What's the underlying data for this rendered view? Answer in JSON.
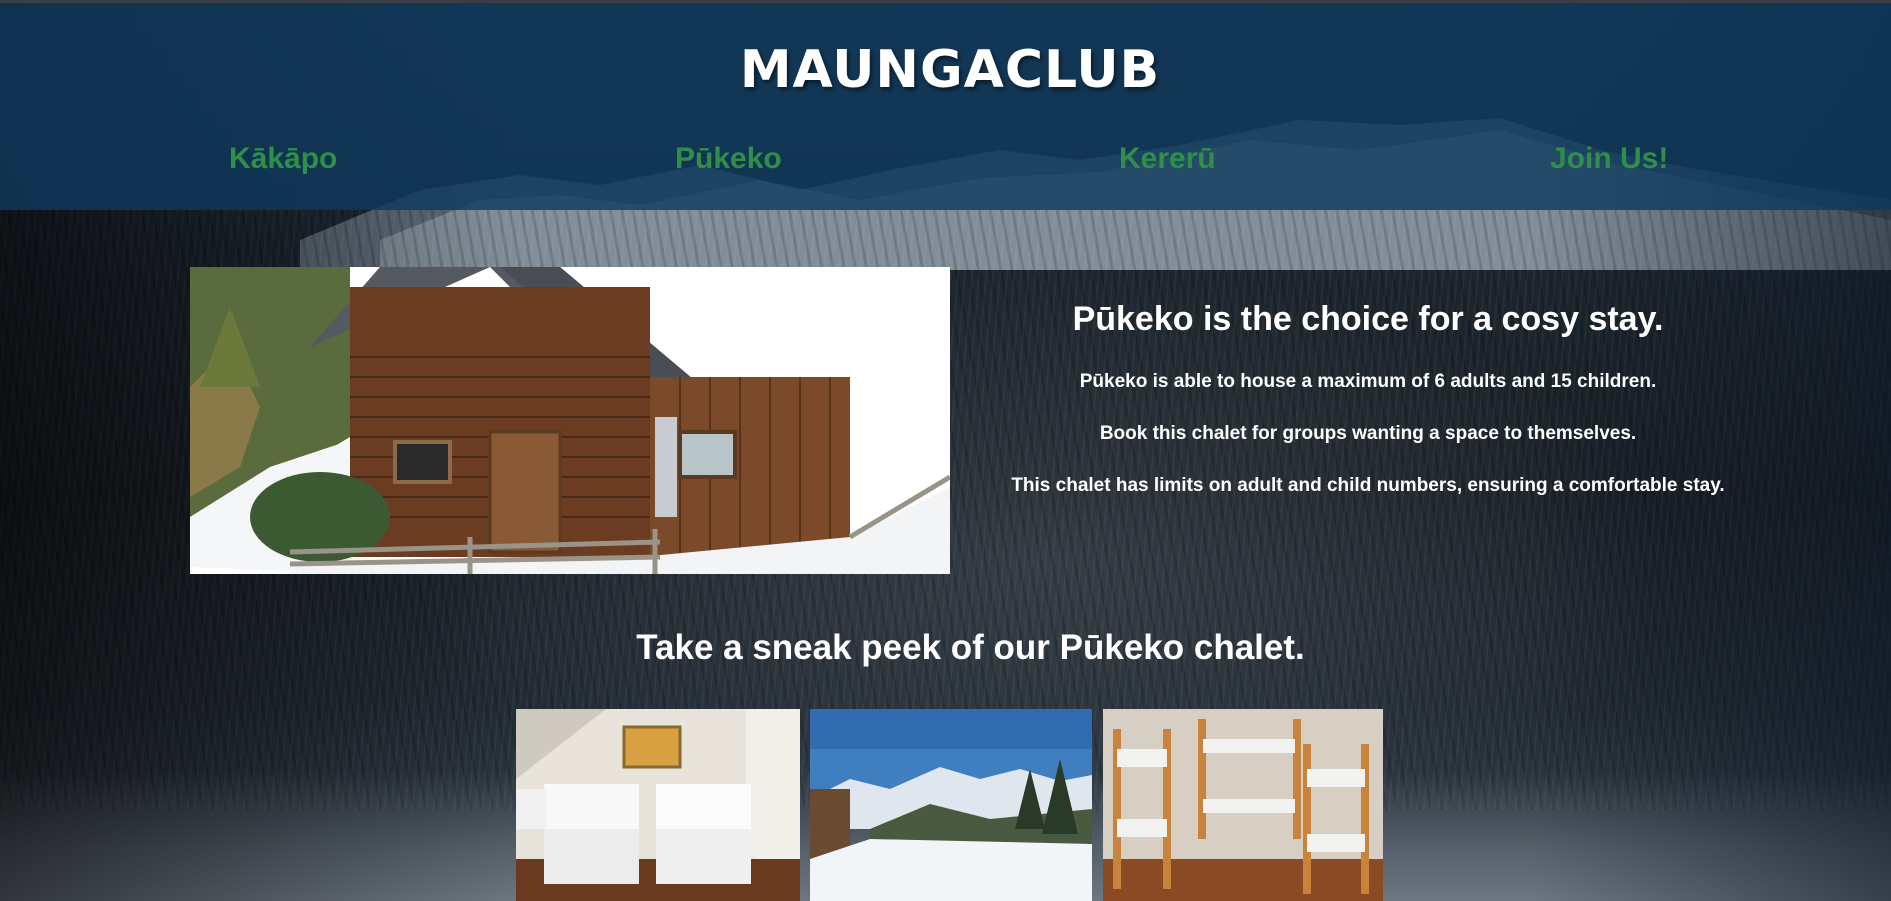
{
  "header": {
    "logo": "MAUNGACLUB"
  },
  "nav": {
    "items": [
      {
        "label": "Kākāpo"
      },
      {
        "label": "Pūkeko"
      },
      {
        "label": "Kererū"
      },
      {
        "label": "Join Us!"
      }
    ],
    "link_color": "#2f8f4a"
  },
  "main": {
    "heading": "Pūkeko is the choice for a cosy stay.",
    "paragraphs": [
      "Pūkeko is able to house a maximum of 6 adults and 15 children.",
      "Book this chalet for groups wanting a space to themselves.",
      "This chalet has limits on adult and child numbers, ensuring a comfortable stay."
    ],
    "gallery_title": "Take a sneak peek of our Pūkeko chalet."
  },
  "colors": {
    "header_bg": "#0e3a5c",
    "text": "#ffffff"
  }
}
